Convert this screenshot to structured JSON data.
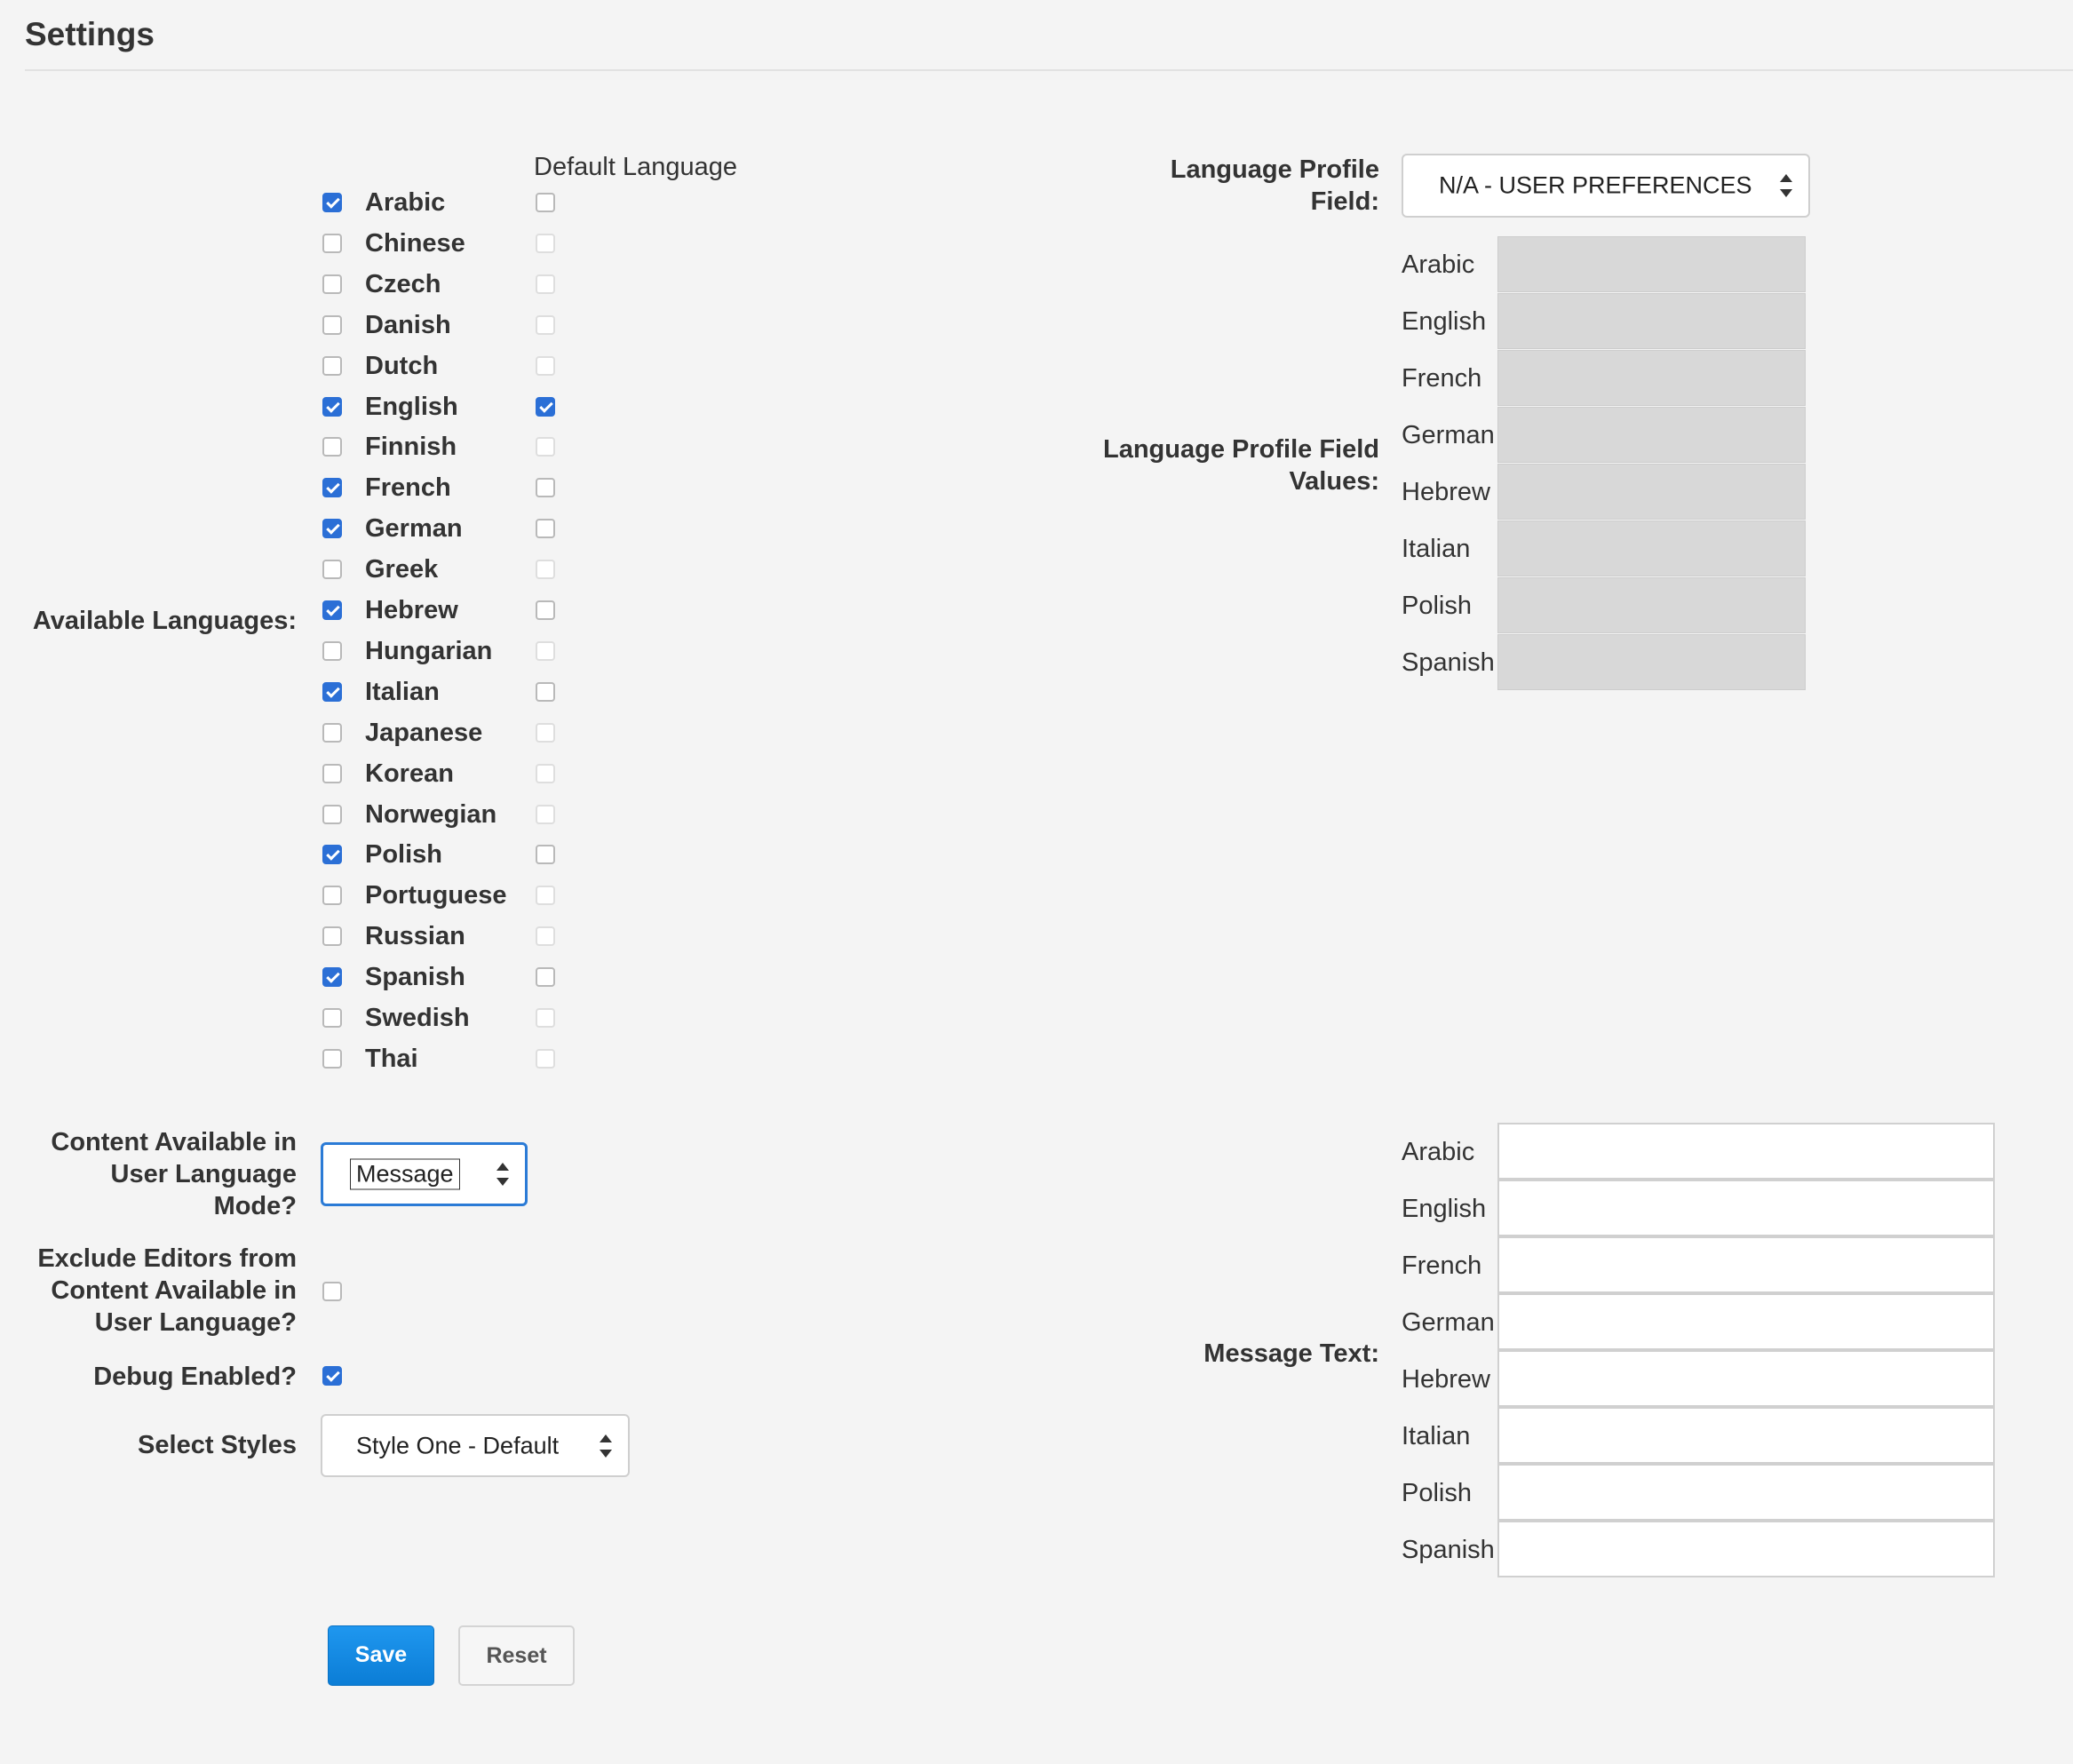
{
  "page": {
    "title": "Settings"
  },
  "languages": {
    "label": "Available Languages:",
    "default_header": "Default Language",
    "items": [
      {
        "name": "Arabic",
        "available": true,
        "default": false
      },
      {
        "name": "Chinese",
        "available": false,
        "default": false
      },
      {
        "name": "Czech",
        "available": false,
        "default": false
      },
      {
        "name": "Danish",
        "available": false,
        "default": false
      },
      {
        "name": "Dutch",
        "available": false,
        "default": false
      },
      {
        "name": "English",
        "available": true,
        "default": true
      },
      {
        "name": "Finnish",
        "available": false,
        "default": false
      },
      {
        "name": "French",
        "available": true,
        "default": false
      },
      {
        "name": "German",
        "available": true,
        "default": false
      },
      {
        "name": "Greek",
        "available": false,
        "default": false
      },
      {
        "name": "Hebrew",
        "available": true,
        "default": false
      },
      {
        "name": "Hungarian",
        "available": false,
        "default": false
      },
      {
        "name": "Italian",
        "available": true,
        "default": false
      },
      {
        "name": "Japanese",
        "available": false,
        "default": false
      },
      {
        "name": "Korean",
        "available": false,
        "default": false
      },
      {
        "name": "Norwegian",
        "available": false,
        "default": false
      },
      {
        "name": "Polish",
        "available": true,
        "default": false
      },
      {
        "name": "Portuguese",
        "available": false,
        "default": false
      },
      {
        "name": "Russian",
        "available": false,
        "default": false
      },
      {
        "name": "Spanish",
        "available": true,
        "default": false
      },
      {
        "name": "Swedish",
        "available": false,
        "default": false
      },
      {
        "name": "Thai",
        "available": false,
        "default": false
      }
    ]
  },
  "language_profile": {
    "field_label": "Language Profile Field:",
    "field_value": "N/A - USER PREFERENCES",
    "values_label": "Language Profile Field Values:",
    "value_languages": [
      "Arabic",
      "English",
      "French",
      "German",
      "Hebrew",
      "Italian",
      "Polish",
      "Spanish"
    ]
  },
  "content_mode": {
    "label": "Content Available in User Language Mode?",
    "value": "Message"
  },
  "exclude_editors": {
    "label": "Exclude Editors from Content Available in User Language?",
    "checked": false
  },
  "debug": {
    "label": "Debug Enabled?",
    "checked": true
  },
  "styles": {
    "label": "Select Styles",
    "value": "Style One - Default"
  },
  "message_text": {
    "label": "Message Text:",
    "languages": [
      "Arabic",
      "English",
      "French",
      "German",
      "Hebrew",
      "Italian",
      "Polish",
      "Spanish"
    ]
  },
  "buttons": {
    "save": "Save",
    "reset": "Reset"
  },
  "colors": {
    "accent": "#2b6fd6",
    "save_button": "#1a8fe6"
  }
}
